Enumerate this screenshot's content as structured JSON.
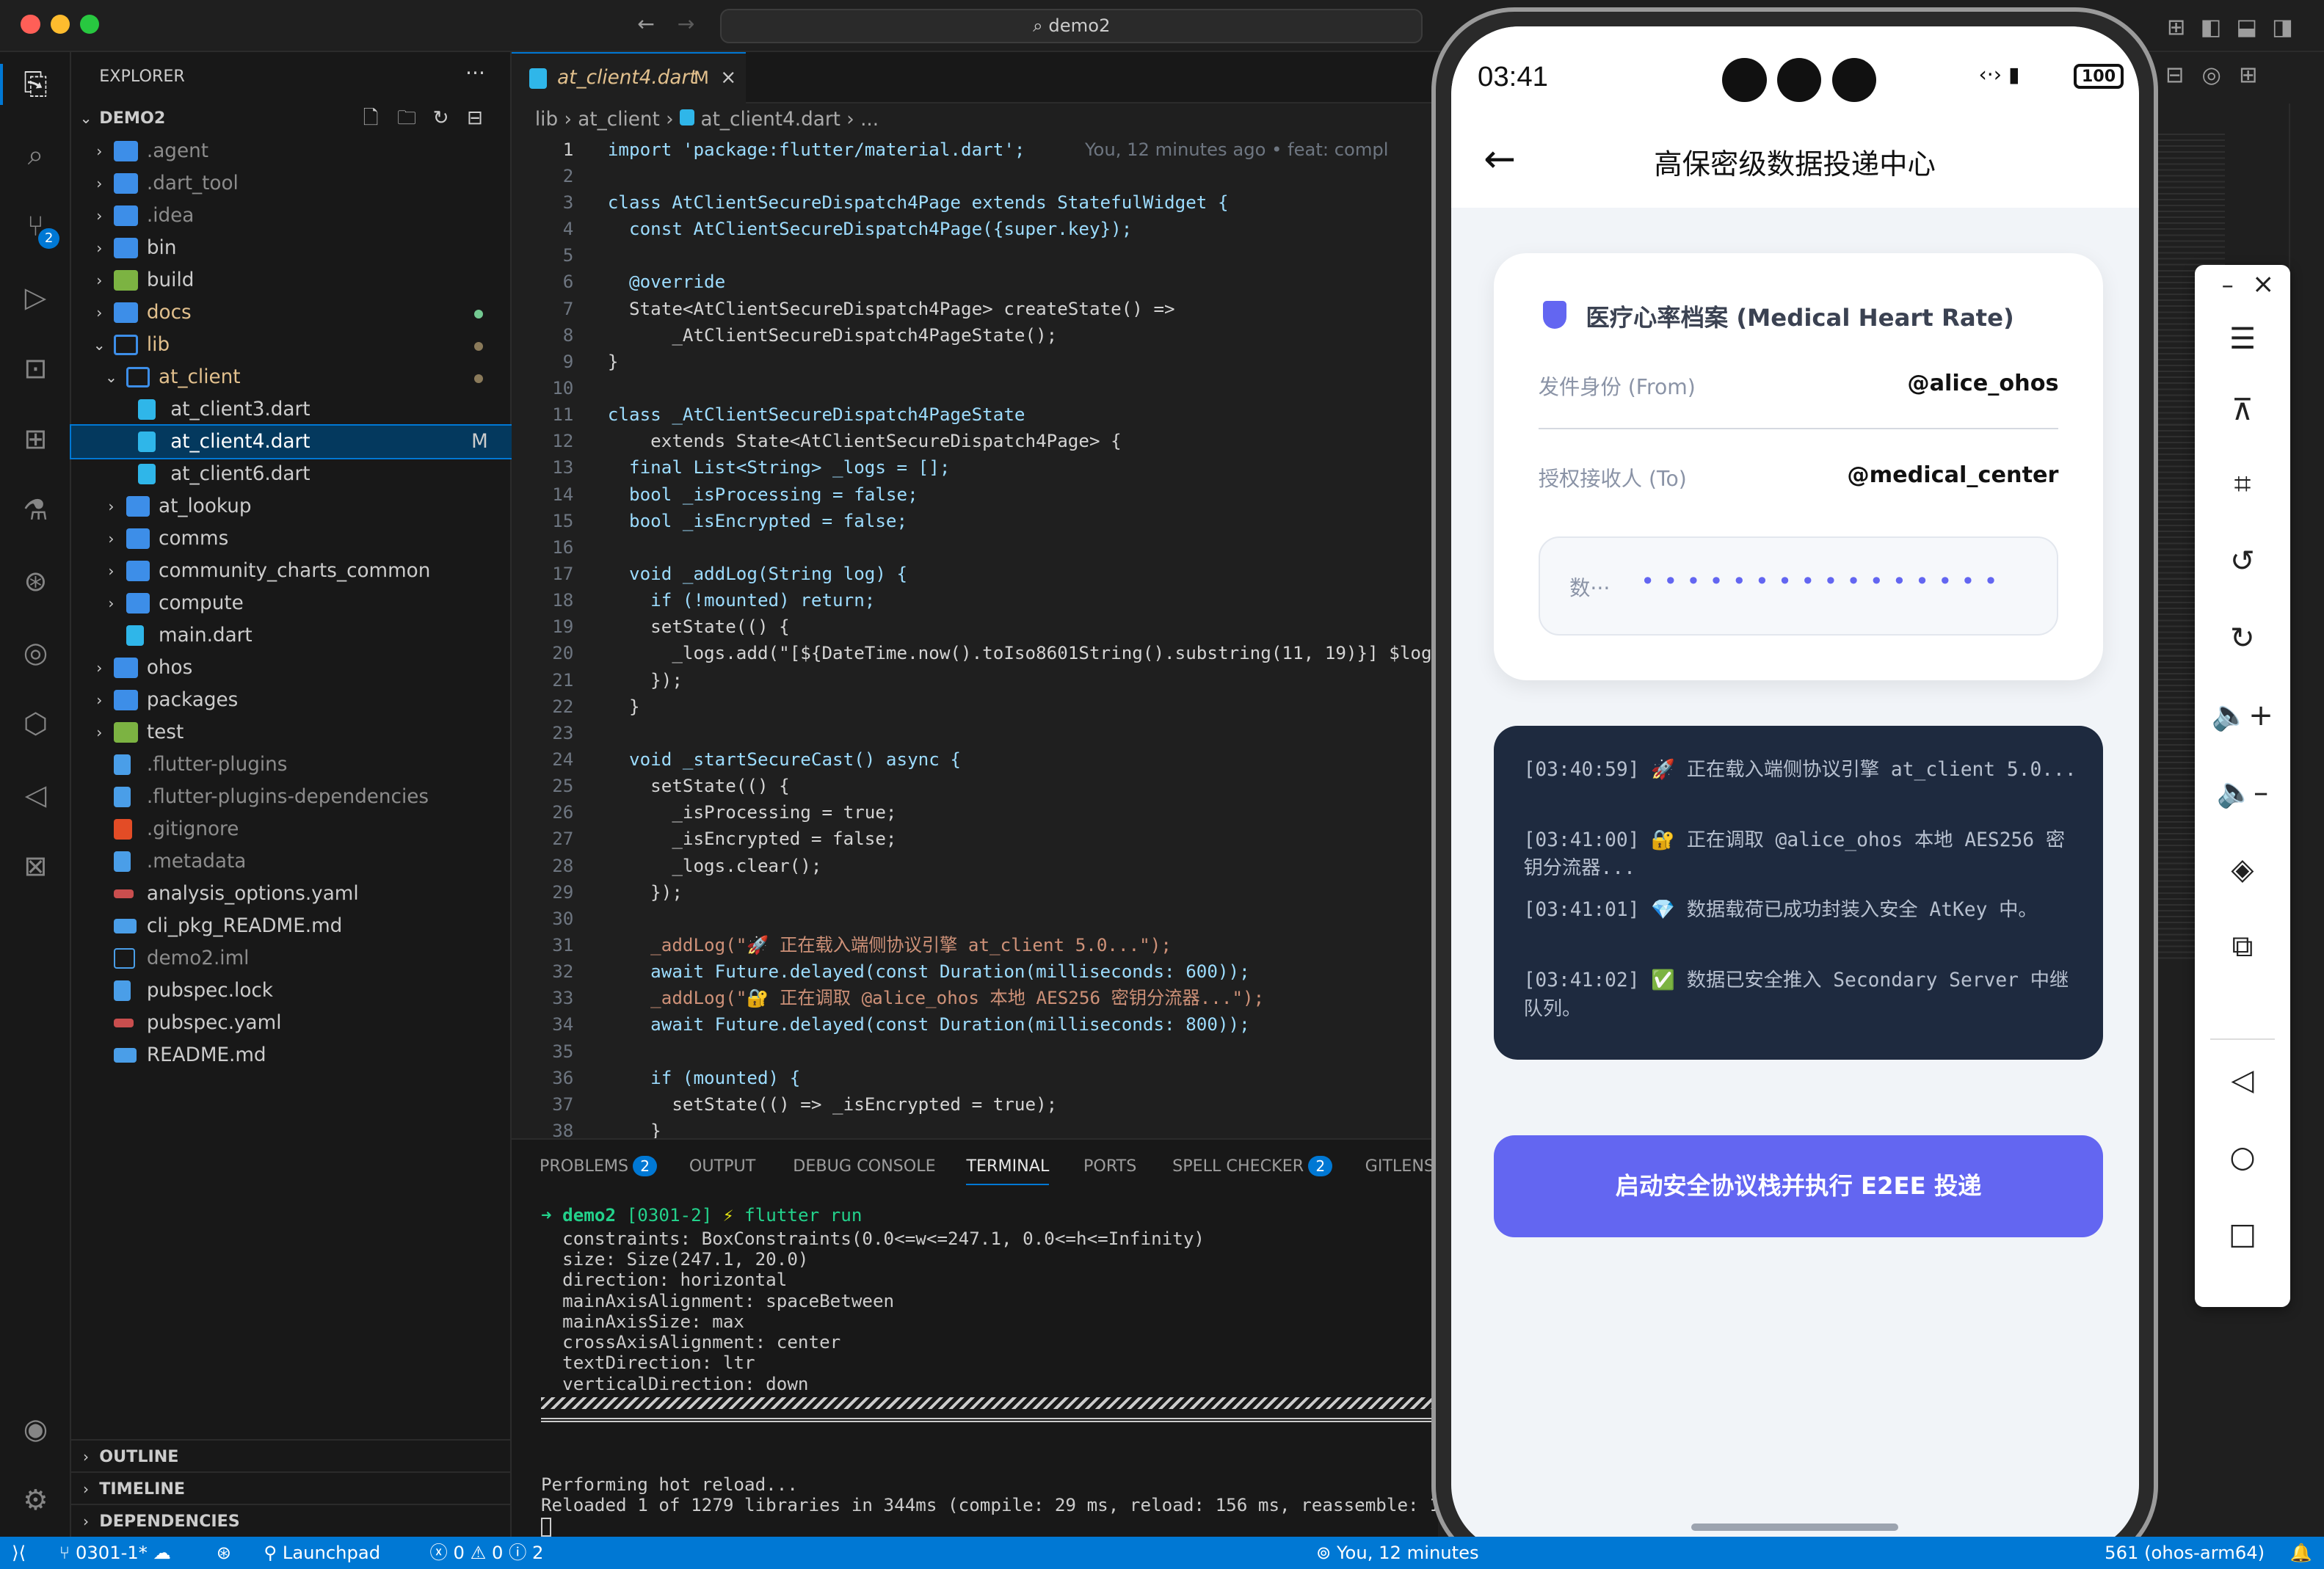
{
  "window": {
    "search": "demo2"
  },
  "explorer": {
    "title": "EXPLORER",
    "root": "DEMO2",
    "items": [
      {
        "label": ".agent",
        "type": "folder",
        "depth": 0
      },
      {
        "label": ".dart_tool",
        "type": "folder",
        "depth": 0
      },
      {
        "label": ".idea",
        "type": "folder",
        "depth": 0
      },
      {
        "label": "bin",
        "type": "folder",
        "depth": 0
      },
      {
        "label": "build",
        "type": "folder",
        "depth": 0
      },
      {
        "label": "docs",
        "type": "folder",
        "depth": 0
      },
      {
        "label": "lib",
        "type": "folder-open",
        "depth": 0
      },
      {
        "label": "at_client",
        "type": "folder-open",
        "depth": 1
      },
      {
        "label": "at_client3.dart",
        "type": "dart",
        "depth": 2
      },
      {
        "label": "at_client4.dart",
        "type": "dart",
        "depth": 2,
        "badge": "M"
      },
      {
        "label": "at_client6.dart",
        "type": "dart",
        "depth": 2
      },
      {
        "label": "at_lookup",
        "type": "folder",
        "depth": 1
      },
      {
        "label": "comms",
        "type": "folder",
        "depth": 1
      },
      {
        "label": "community_charts_common",
        "type": "folder",
        "depth": 1
      },
      {
        "label": "compute",
        "type": "folder",
        "depth": 1
      },
      {
        "label": "main.dart",
        "type": "dart",
        "depth": 1
      },
      {
        "label": "ohos",
        "type": "folder",
        "depth": 0
      },
      {
        "label": "packages",
        "type": "folder",
        "depth": 0
      },
      {
        "label": "test",
        "type": "folder",
        "depth": 0
      },
      {
        "label": ".flutter-plugins",
        "type": "file",
        "depth": 0
      },
      {
        "label": ".flutter-plugins-dependencies",
        "type": "file",
        "depth": 0
      },
      {
        "label": ".gitignore",
        "type": "git",
        "depth": 0
      },
      {
        "label": ".metadata",
        "type": "file",
        "depth": 0
      },
      {
        "label": "analysis_options.yaml",
        "type": "yaml",
        "depth": 0
      },
      {
        "label": "cli_pkg_README.md",
        "type": "md",
        "depth": 0
      },
      {
        "label": "demo2.iml",
        "type": "xml",
        "depth": 0
      },
      {
        "label": "pubspec.lock",
        "type": "file",
        "depth": 0
      },
      {
        "label": "pubspec.yaml",
        "type": "yaml",
        "depth": 0
      },
      {
        "label": "README.md",
        "type": "md",
        "depth": 0
      }
    ],
    "sections": [
      "OUTLINE",
      "TIMELINE",
      "DEPENDENCIES"
    ]
  },
  "editor": {
    "tab": "at_client4.dart",
    "tab_badge": "M",
    "breadcrumb": [
      "lib",
      "at_client",
      "at_client4.dart",
      "..."
    ],
    "blame": "You, 12 minutes ago • feat: compl",
    "lines": [
      "import 'package:flutter/material.dart';",
      "",
      "class AtClientSecureDispatch4Page extends StatefulWidget {",
      "  const AtClientSecureDispatch4Page({super.key});",
      "",
      "  @override",
      "  State<AtClientSecureDispatch4Page> createState() =>",
      "      _AtClientSecureDispatch4PageState();",
      "}",
      "",
      "class _AtClientSecureDispatch4PageState",
      "    extends State<AtClientSecureDispatch4Page> {",
      "  final List<String> _logs = [];",
      "  bool _isProcessing = false;",
      "  bool _isEncrypted = false;",
      "",
      "  void _addLog(String log) {",
      "    if (!mounted) return;",
      "    setState(() {",
      "      _logs.add(\"[${DateTime.now().toIso8601String().substring(11, 19)}] $log\"",
      "    });",
      "  }",
      "",
      "  void _startSecureCast() async {",
      "    setState(() {",
      "      _isProcessing = true;",
      "      _isEncrypted = false;",
      "      _logs.clear();",
      "    });",
      "",
      "    _addLog(\"🚀 正在载入端侧协议引擎 at_client 5.0...\");",
      "    await Future.delayed(const Duration(milliseconds: 600));",
      "    _addLog(\"🔐 正在调取 @alice_ohos 本地 AES256 密钥分流器...\");",
      "    await Future.delayed(const Duration(milliseconds: 800));",
      "",
      "    if (mounted) {",
      "      setState(() => _isEncrypted = true);",
      "    }"
    ]
  },
  "panel": {
    "tabs": [
      {
        "label": "PROBLEMS",
        "badge": "2"
      },
      {
        "label": "OUTPUT"
      },
      {
        "label": "DEBUG CONSOLE"
      },
      {
        "label": "TERMINAL",
        "active": true
      },
      {
        "label": "PORTS"
      },
      {
        "label": "SPELL CHECKER",
        "badge": "2"
      },
      {
        "label": "GITLENS"
      }
    ],
    "prompt_dir": "demo2",
    "prompt_branch": "[0301-2]",
    "prompt_cmd": "flutter run",
    "lines": [
      "  constraints: BoxConstraints(0.0<=w<=247.1, 0.0<=h<=Infinity)",
      "  size: Size(247.1, 20.0)",
      "  direction: horizontal",
      "  mainAxisAlignment: spaceBetween",
      "  mainAxisSize: max",
      "  crossAxisAlignment: center",
      "  textDirection: ltr",
      "  verticalDirection: down"
    ],
    "reload1": "Performing hot reload...",
    "reload2": "Reloaded 1 of 1279 libraries in 344ms (compile: 29 ms, reload: 156 ms, reassemble: 120 m"
  },
  "status": {
    "branch": "0301-1*",
    "launchpad": "Launchpad",
    "errors": "0",
    "warnings": "0",
    "infos": "2",
    "blame": "You, 12 minutes",
    "device": "561 (ohos-arm64)"
  },
  "phone": {
    "time": "03:41",
    "battery": "100",
    "title": "高保密级数据投递中心",
    "card_title": "医疗心率档案 (Medical Heart Rate)",
    "from_label": "发件身份 (From)",
    "from_value": "@alice_ohos",
    "to_label": "授权接收人 (To)",
    "to_value": "@medical_center",
    "data_label": "数···",
    "logs": [
      {
        "time": "[03:40:59]",
        "icon": "🚀",
        "text": "正在载入端侧协议引擎 at_client 5.0..."
      },
      {
        "time": "[03:41:00]",
        "icon": "🔐",
        "text": "正在调取 @alice_ohos 本地 AES256 密钥分流器..."
      },
      {
        "time": "[03:41:01]",
        "icon": "💎",
        "text": "数据载荷已成功封装入安全 AtKey 中。"
      },
      {
        "time": "[03:41:02]",
        "icon": "✅",
        "text": "数据已安全推入 Secondary Server 中继队列。"
      }
    ],
    "button": "启动安全协议栈并执行 E2EE 投递"
  },
  "colors": {
    "accent": "#0078d4",
    "phone_button": "#6366f1",
    "log_bg": "#1e2a3f",
    "shield": "#6366f1"
  }
}
